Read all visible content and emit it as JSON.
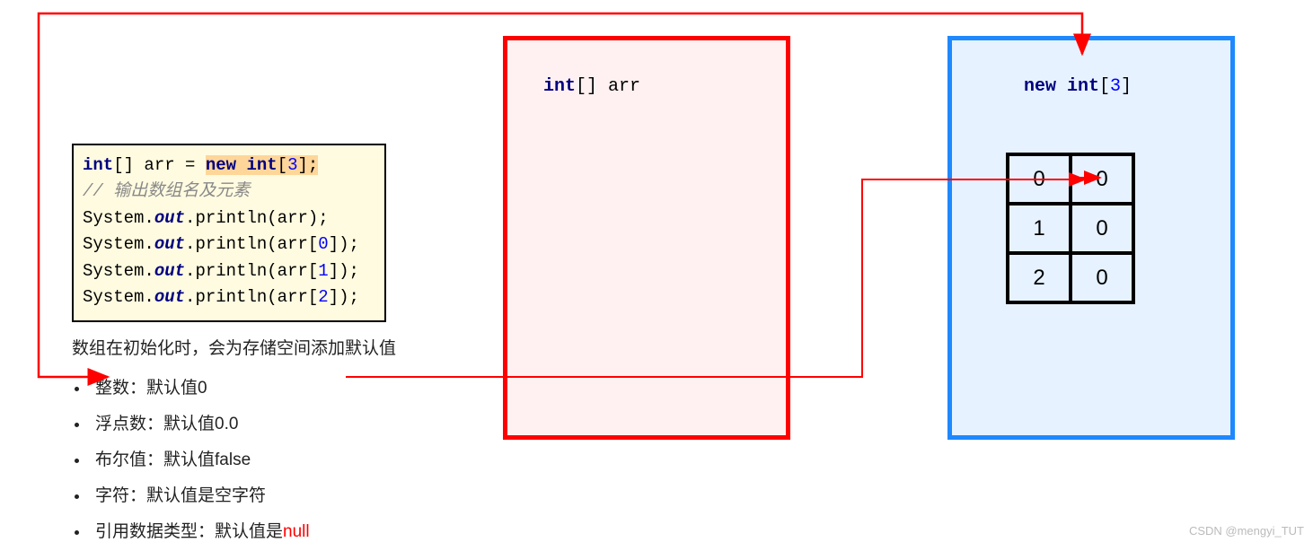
{
  "code": {
    "line1_a": "int",
    "line1_b": "[] arr = ",
    "line1_c": "new int",
    "line1_d": "[",
    "line1_e": "3",
    "line1_f": "];",
    "comment": "// 输出数组名及元素",
    "line3_a": "System.",
    "line3_b": "out",
    "line3_c": ".println(arr);",
    "line4_a": "System.",
    "line4_b": "out",
    "line4_c": ".println(arr[",
    "line4_d": "0",
    "line4_e": "]);",
    "line5_a": "System.",
    "line5_b": "out",
    "line5_c": ".println(arr[",
    "line5_d": "1",
    "line5_e": "]);",
    "line6_a": "System.",
    "line6_b": "out",
    "line6_c": ".println(arr[",
    "line6_d": "2",
    "line6_e": "]);"
  },
  "stack_label_a": "int",
  "stack_label_b": "[] arr",
  "heap_label_a": "new int",
  "heap_label_b": "[",
  "heap_label_c": "3",
  "heap_label_d": "]",
  "arr_table": {
    "r0c0": "0",
    "r0c1": "0",
    "r1c0": "1",
    "r1c1": "0",
    "r2c0": "2",
    "r2c1": "0"
  },
  "notes": {
    "heading": "数组在初始化时，会为存储空间添加默认值",
    "b1": "整数：默认值0",
    "b2": "浮点数：默认值0.0",
    "b3": "布尔值：默认值false",
    "b4": "字符：默认值是空字符",
    "b5_a": "引用数据类型：默认值是",
    "b5_b": "null"
  },
  "watermark": "CSDN @mengyi_TUT"
}
